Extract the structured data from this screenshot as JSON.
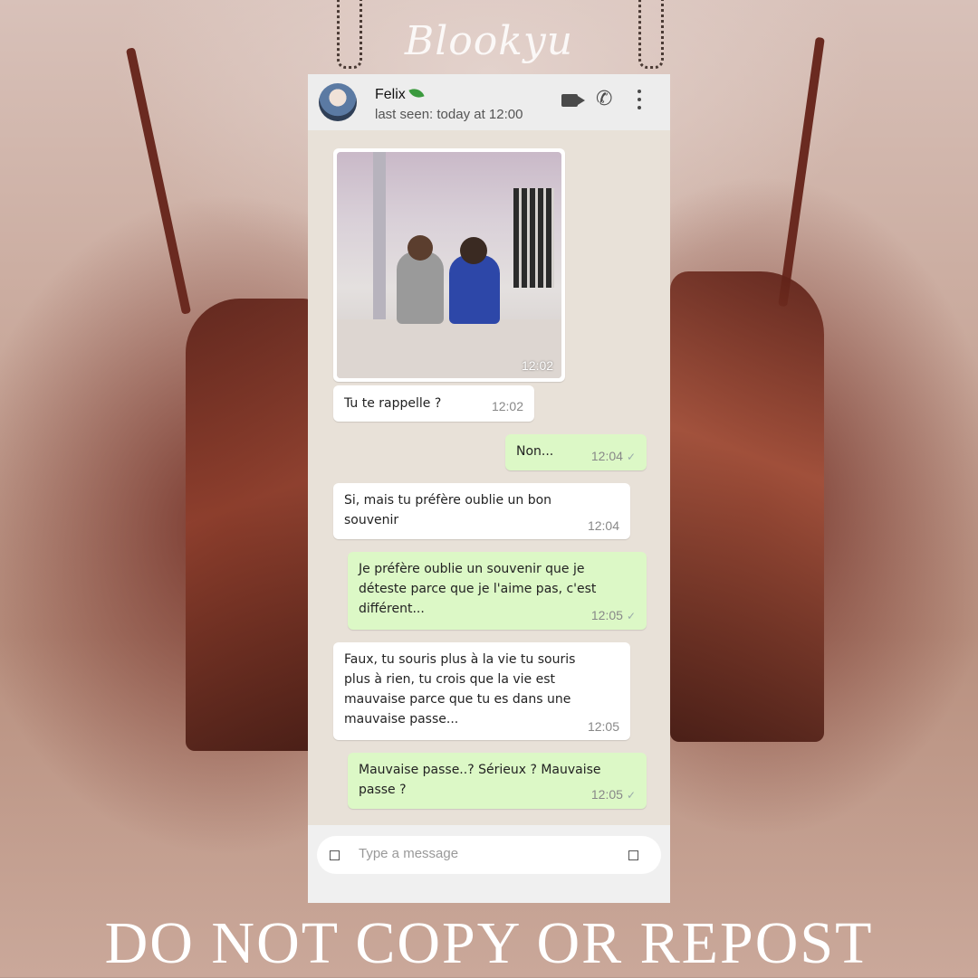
{
  "watermark": "Blookyu",
  "notice": "DO NOT COPY OR REPOST",
  "header": {
    "contact_name": "Felix",
    "last_seen": "last seen: today at 12:00"
  },
  "messages": [
    {
      "type": "image",
      "direction": "in",
      "time": "12:02"
    },
    {
      "type": "text",
      "direction": "in",
      "text": "Tu te rappelle ?",
      "time": "12:02"
    },
    {
      "type": "text",
      "direction": "out",
      "text": "Non...",
      "time": "12:04"
    },
    {
      "type": "text",
      "direction": "in",
      "lines": [
        "Si, mais tu préfère oublie un bon",
        "souvenir"
      ],
      "time": "12:04"
    },
    {
      "type": "text",
      "direction": "out",
      "lines": [
        "Je préfère oublie un souvenir que je",
        "déteste parce que je l'aime pas, c'est",
        "différent..."
      ],
      "time": "12:05"
    },
    {
      "type": "text",
      "direction": "in",
      "lines": [
        "Faux, tu souris plus à la vie tu souris",
        "plus à rien, tu crois que la vie est",
        "mauvaise parce que tu es dans une",
        "mauvaise passe..."
      ],
      "time": "12:05"
    },
    {
      "type": "text",
      "direction": "out",
      "lines": [
        "Mauvaise passe..? Sérieux ? Mauvaise",
        "passe ?"
      ],
      "time": "12:05"
    }
  ],
  "composer": {
    "placeholder": "Type a message"
  },
  "icons": {
    "video": "video-call-icon",
    "call": "phone-icon",
    "menu": "more-vert-icon",
    "emoji": "emoji-icon",
    "attach": "attach-icon",
    "delivered": "check-icon"
  },
  "colors": {
    "incoming_bubble": "#ffffff",
    "outgoing_bubble": "#dcf8c6",
    "chat_background": "#e8e1d8",
    "header_background": "#ededed"
  }
}
